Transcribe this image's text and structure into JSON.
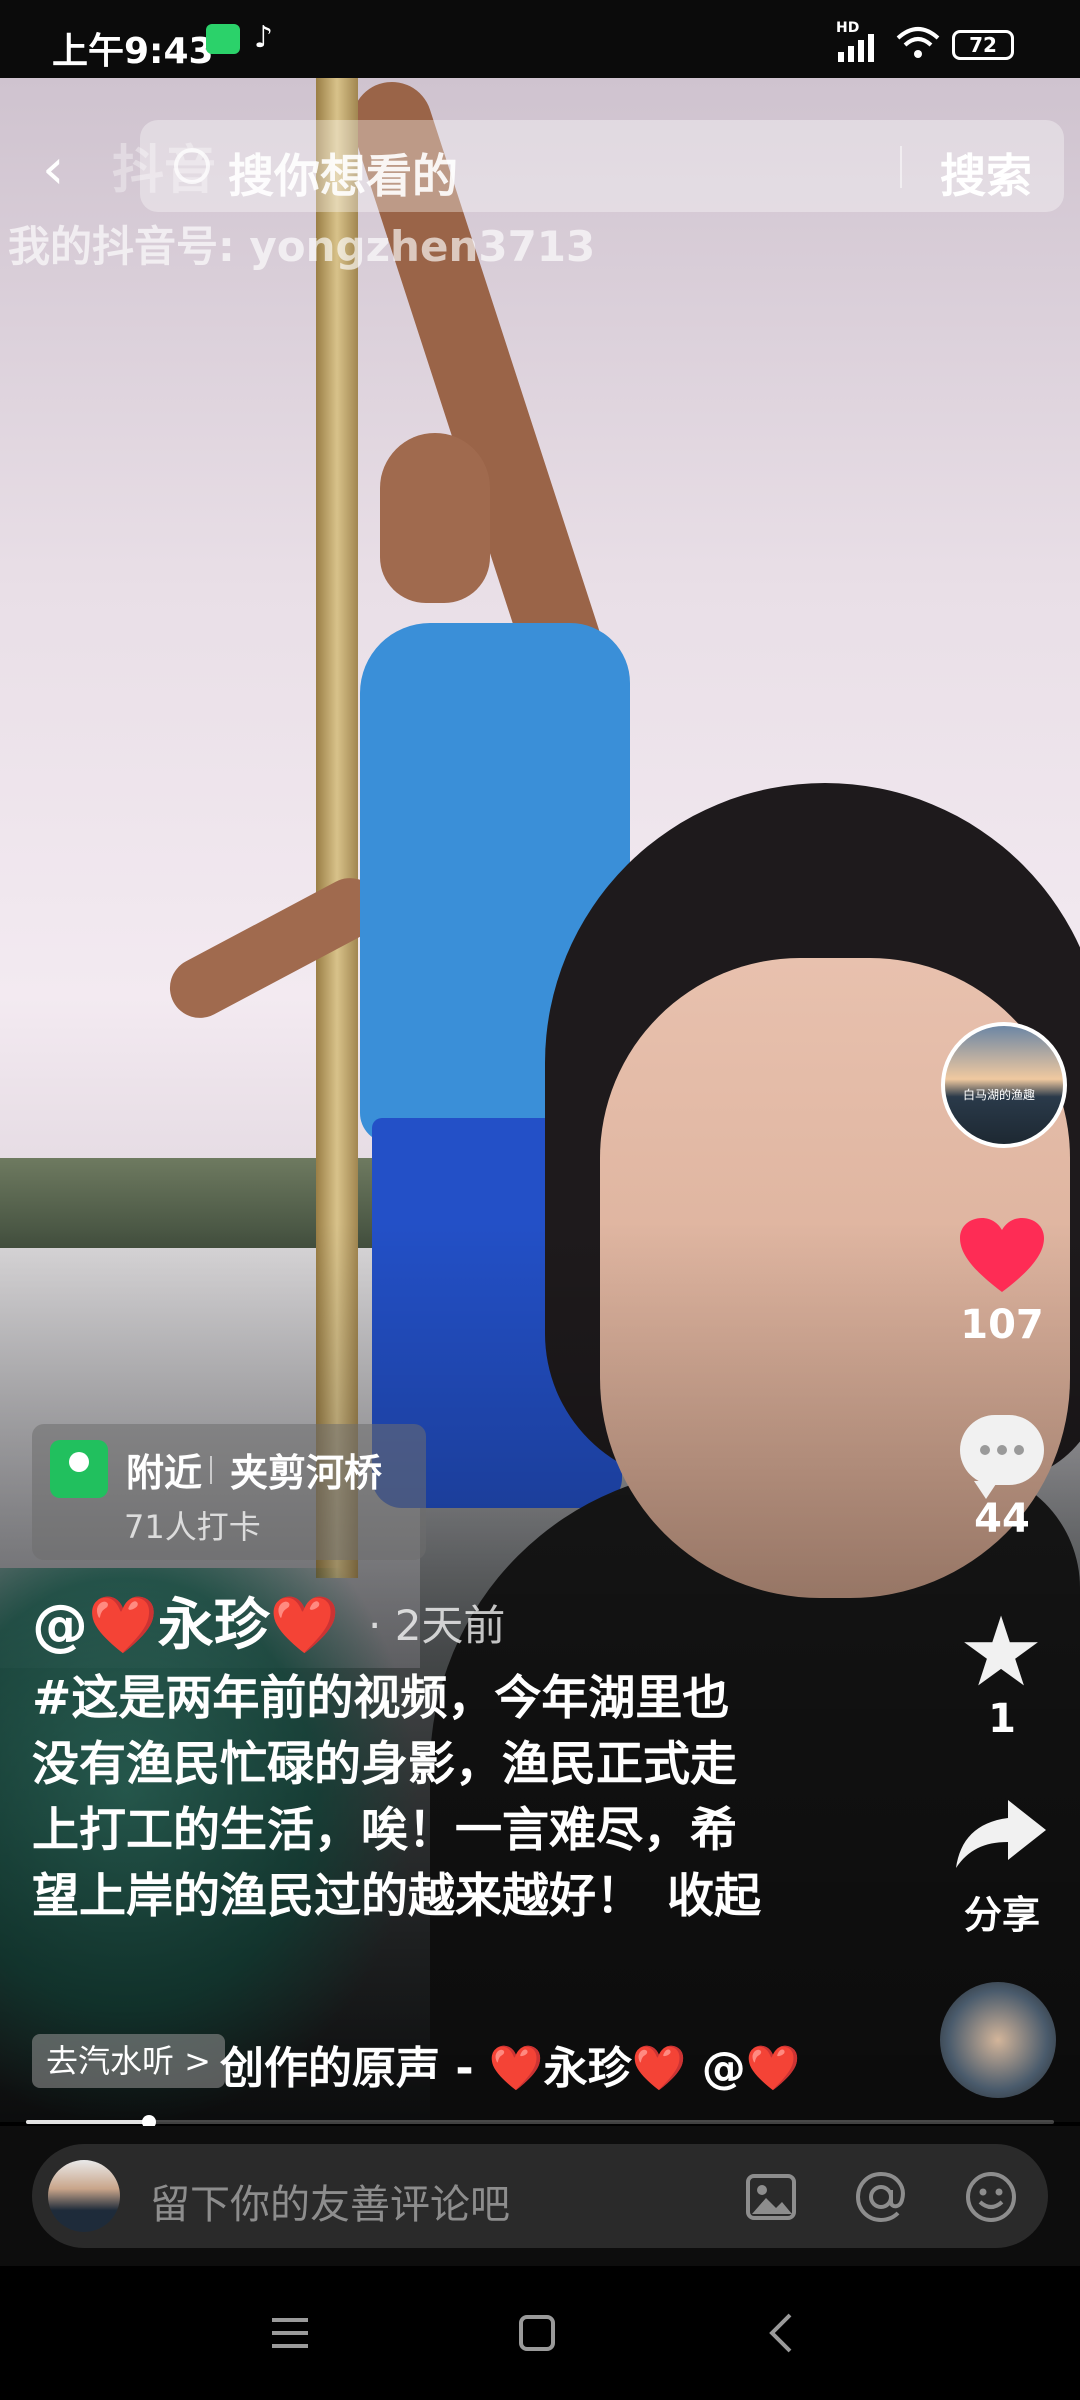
{
  "status_bar": {
    "time": "上午9:43",
    "network": "HD",
    "battery": "72"
  },
  "search": {
    "logo_text": "抖音",
    "placeholder": "搜你想看的",
    "button": "搜索"
  },
  "watermark": "我的抖音号: yongzhen3713",
  "right_rail": {
    "avatar_caption": "白马湖的渔趣",
    "likes": "107",
    "comments": "44",
    "favorites": "1",
    "share_label": "分享"
  },
  "location": {
    "nearby": "附近",
    "name": "夹剪河桥",
    "checkins": "71人打卡"
  },
  "post": {
    "author": "@❤️永珍❤️",
    "time_ago": "· 2天前",
    "caption": "#这是两年前的视频，今年湖里也没有渔民忙碌的身影，渔民正式走上打工的生活，唉！一言难尽，希望上岸的渔民过的越来越好！",
    "collapse": "收起"
  },
  "music": {
    "listen_pill": "去汽水听 >",
    "text": "创作的原声 - ❤️永珍❤️     @❤️"
  },
  "playback": {
    "progress": 0.12
  },
  "comment_bar": {
    "placeholder": "留下你的友善评论吧"
  },
  "icons": {
    "back": "chevron-left-icon",
    "search": "search-icon",
    "like": "heart-icon",
    "comment": "comment-icon",
    "favorite": "star-icon",
    "share": "share-icon",
    "image": "image-icon",
    "mention": "at-icon",
    "emoji": "emoji-icon"
  },
  "colors": {
    "like_red": "#fe2c55",
    "location_green": "#21c05e"
  }
}
